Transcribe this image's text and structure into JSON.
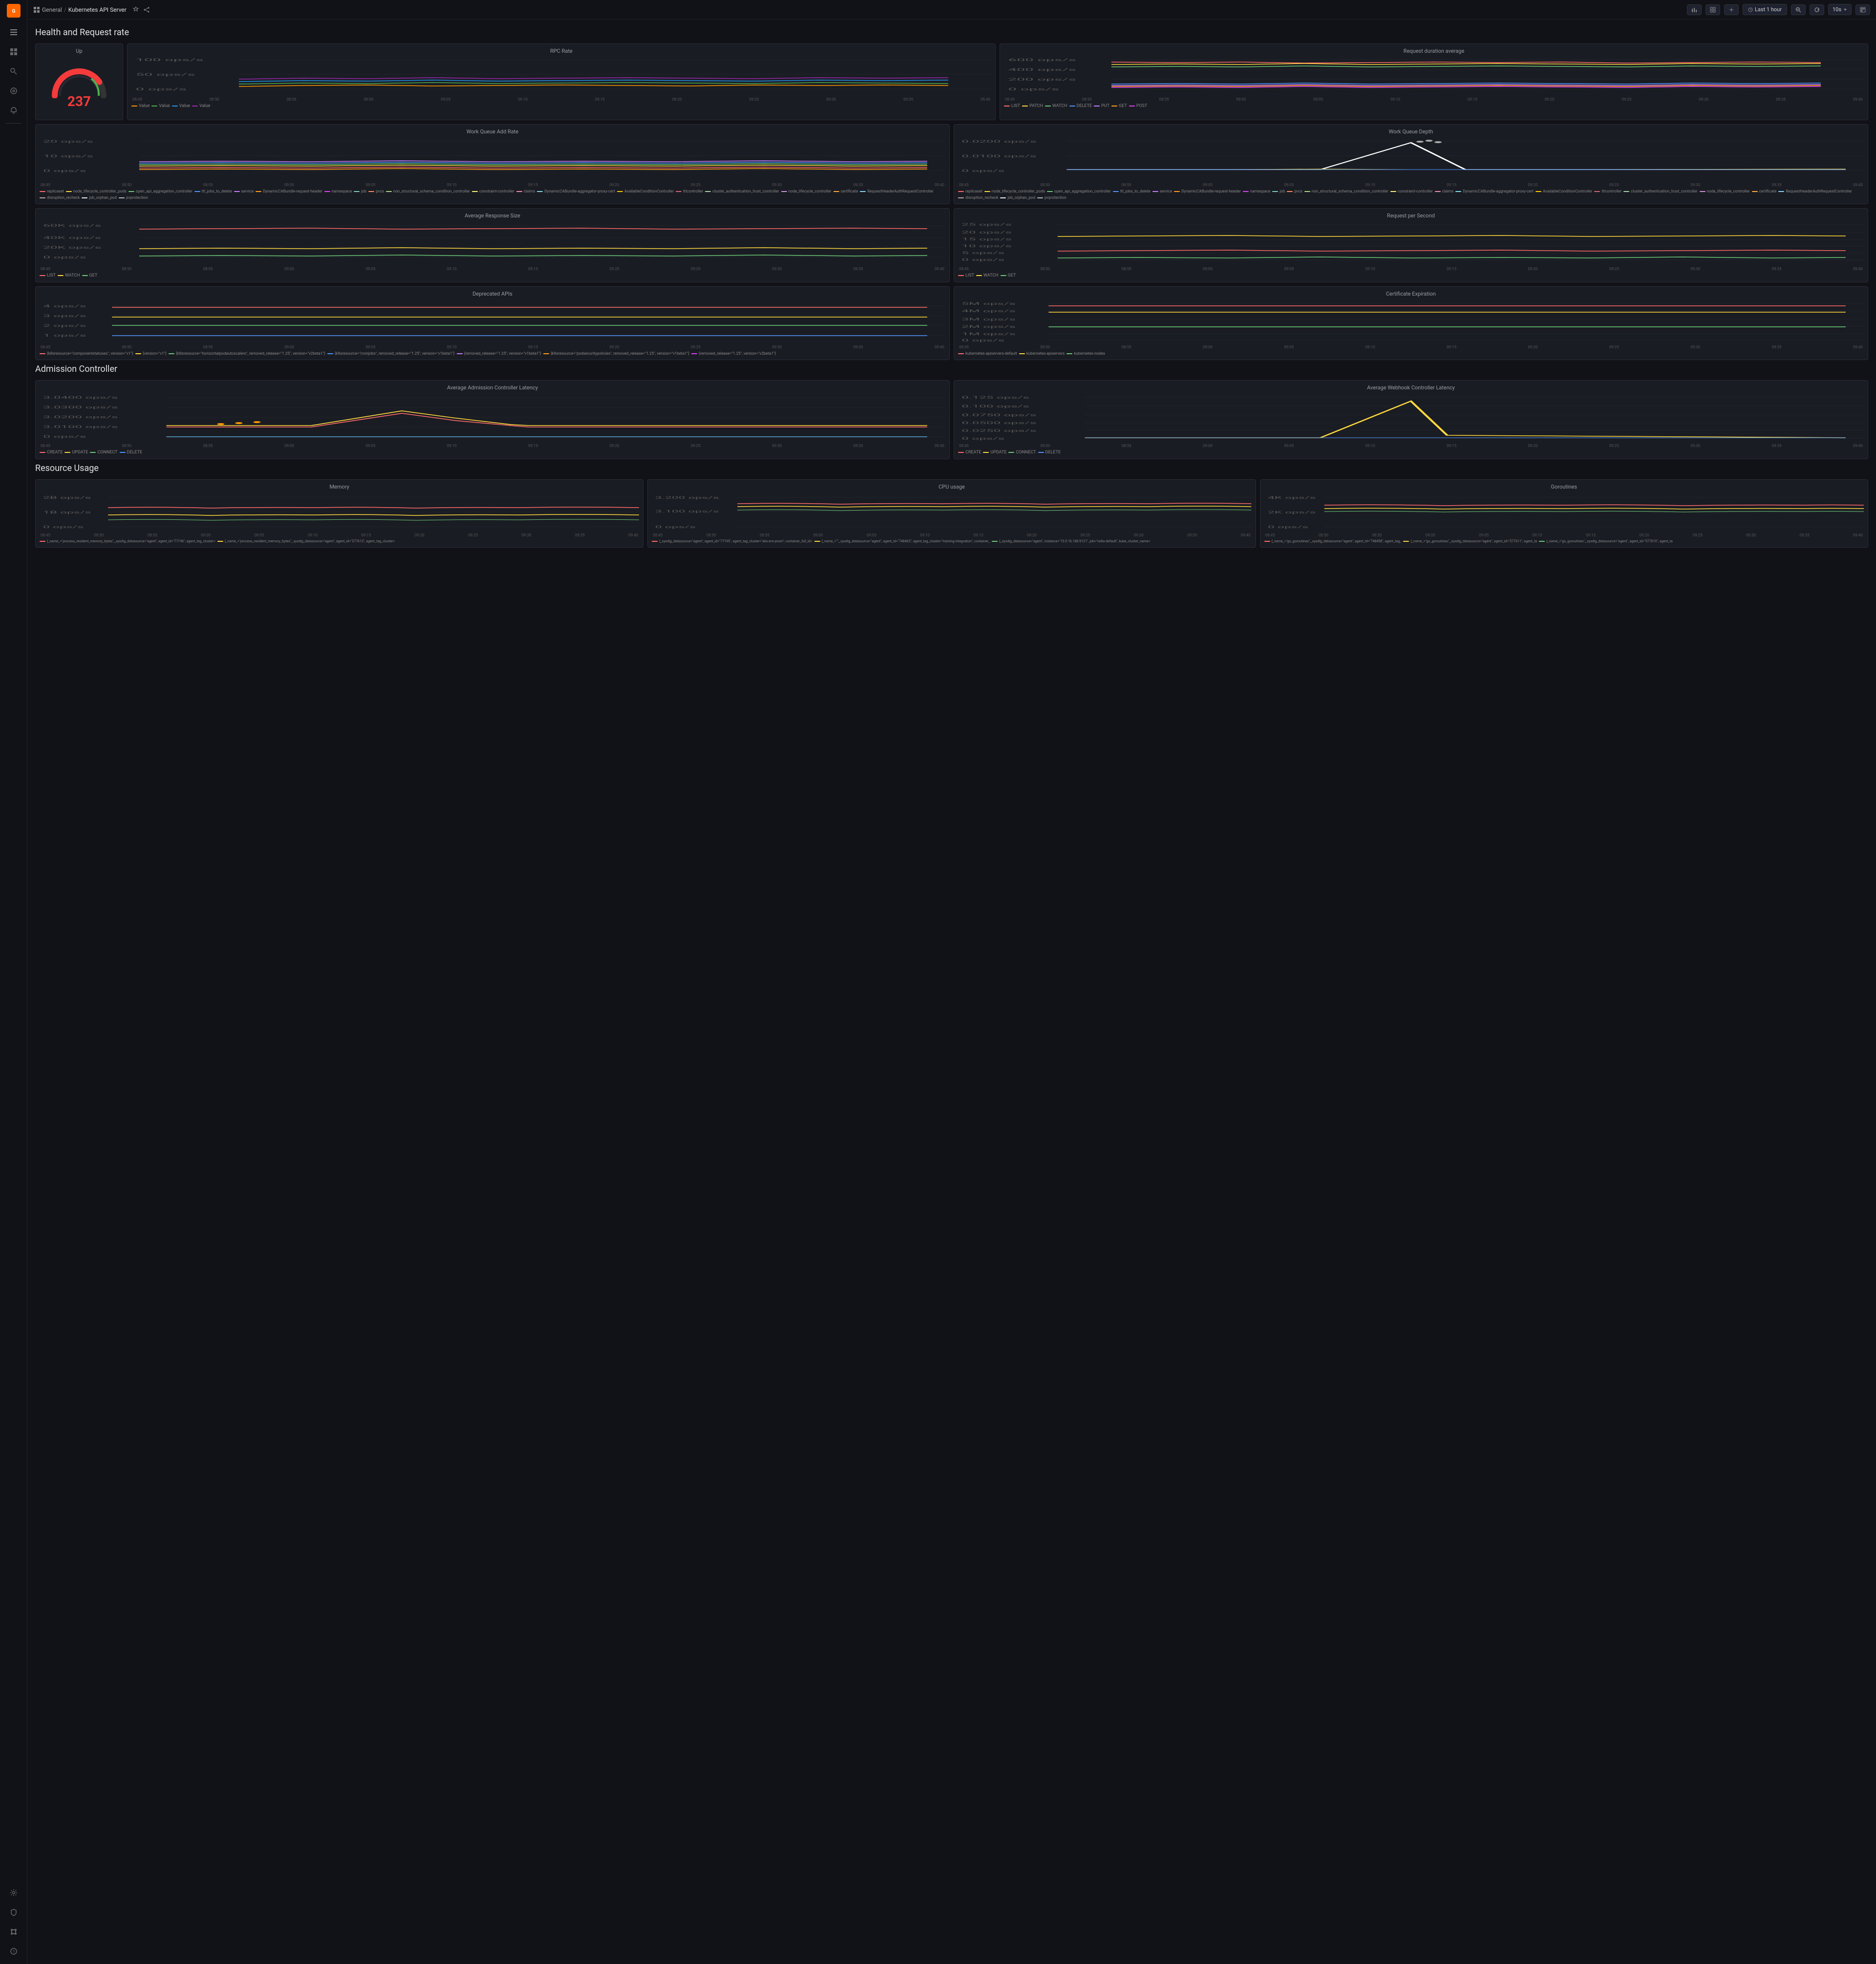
{
  "app": {
    "logo": "G",
    "breadcrumb": {
      "parent": "General",
      "separator": "/",
      "current": "Kubernetes API Server"
    }
  },
  "topbar": {
    "timeRange": "Last 1 hour",
    "zoom": "10s",
    "icons": [
      "chart-icon",
      "settings-icon",
      "gear-icon",
      "clock-icon",
      "magnify-icon",
      "refresh-icon",
      "tv-icon"
    ]
  },
  "sections": {
    "health": {
      "title": "Health and Request rate",
      "panels": {
        "up": {
          "title": "Up",
          "value": "237",
          "max": 400
        },
        "rpcRate": {
          "title": "RPC Rate",
          "yLabels": [
            "100 ops/s",
            "50 ops/s",
            "0 ops/s"
          ],
          "legend": [
            {
              "label": "Value",
              "color": "#ff9800"
            },
            {
              "label": "Value",
              "color": "#4caf50"
            },
            {
              "label": "Value",
              "color": "#2196f3"
            },
            {
              "label": "Value",
              "color": "#9c27b0"
            }
          ]
        },
        "requestDuration": {
          "title": "Request duration average",
          "yLabels": [
            "600 ops/s",
            "400 ops/s",
            "200 ops/s",
            "0 ops/s"
          ],
          "legend": [
            {
              "label": "LIST",
              "color": "#ff6b6b"
            },
            {
              "label": "PATCH",
              "color": "#ffd93d"
            },
            {
              "label": "WATCH",
              "color": "#6bcb77"
            },
            {
              "label": "DELETE",
              "color": "#4d96ff"
            },
            {
              "label": "PUT",
              "color": "#c77dff"
            },
            {
              "label": "GET",
              "color": "#ff9f1c"
            },
            {
              "label": "POST",
              "color": "#e040fb"
            }
          ]
        },
        "workQueueAddRate": {
          "title": "Work Queue Add Rate",
          "yLabels": [
            "20 ops/s",
            "10 ops/s",
            "0 ops/s"
          ],
          "legend": [
            {
              "label": "replicaset",
              "color": "#ff6b6b"
            },
            {
              "label": "node_lifecycle_controller_pods",
              "color": "#ffd93d"
            },
            {
              "label": "open_api_aggregation_controller",
              "color": "#6bcb77"
            },
            {
              "label": "ttl_jobs_to_delete",
              "color": "#4d96ff"
            },
            {
              "label": "service",
              "color": "#c77dff"
            },
            {
              "label": "DynamicCABundle-request-header",
              "color": "#ff9f1c"
            },
            {
              "label": "namespace",
              "color": "#e040fb"
            },
            {
              "label": "job",
              "color": "#80cbc4"
            },
            {
              "label": "pvcs",
              "color": "#ff8a65"
            },
            {
              "label": "non_structural_schema_condition_controller",
              "color": "#aed581"
            },
            {
              "label": "constraint-controller",
              "color": "#fff176"
            },
            {
              "label": "claims",
              "color": "#f48fb1"
            },
            {
              "label": "DynamicCABundle-aggregator-proxy-cert",
              "color": "#80deea"
            },
            {
              "label": "AvailableConditionController",
              "color": "#ffcc02"
            },
            {
              "label": "ttlcontroller",
              "color": "#cf6679"
            },
            {
              "label": "cluster_authentication_trust_controller",
              "color": "#a5d6a7"
            },
            {
              "label": "node_lifecycle_controller",
              "color": "#ce93d8"
            },
            {
              "label": "certificate",
              "color": "#ffab40"
            },
            {
              "label": "RequestHeaderAuthRequestController",
              "color": "#81d4fa"
            },
            {
              "label": "disruption_recheck",
              "color": "#bcaaa4"
            },
            {
              "label": "job_orphan_pod",
              "color": "#eeeeee"
            },
            {
              "label": "pvprotection",
              "color": "#b0bec5"
            }
          ]
        },
        "workQueueDepth": {
          "title": "Work Queue Depth",
          "yLabels": [
            "0.0200 ops/s",
            "0.0100 ops/s",
            "0 ops/s"
          ],
          "legend": [
            {
              "label": "replicaset",
              "color": "#ff6b6b"
            },
            {
              "label": "node_lifecycle_controller_pods",
              "color": "#ffd93d"
            },
            {
              "label": "open_api_aggregation_controller",
              "color": "#6bcb77"
            },
            {
              "label": "ttl_jobs_to_delete",
              "color": "#4d96ff"
            },
            {
              "label": "service",
              "color": "#c77dff"
            },
            {
              "label": "DynamicCABundle-request-header",
              "color": "#ff9f1c"
            },
            {
              "label": "namespace",
              "color": "#e040fb"
            },
            {
              "label": "job",
              "color": "#80cbc4"
            },
            {
              "label": "pvcs",
              "color": "#ff8a65"
            },
            {
              "label": "non_structural_schema_condition_controller",
              "color": "#aed581"
            },
            {
              "label": "constraint-controller",
              "color": "#fff176"
            },
            {
              "label": "claims",
              "color": "#f48fb1"
            },
            {
              "label": "DynamicCABundle-aggregator-proxy-cert",
              "color": "#80deea"
            },
            {
              "label": "AvailableConditionController",
              "color": "#ffcc02"
            },
            {
              "label": "ttlcontroller",
              "color": "#cf6679"
            },
            {
              "label": "cluster_authentication_trust_controller",
              "color": "#a5d6a7"
            },
            {
              "label": "node_lifecycle_controller",
              "color": "#ce93d8"
            },
            {
              "label": "certificate",
              "color": "#ffab40"
            },
            {
              "label": "RequestHeaderAuthRequestController",
              "color": "#81d4fa"
            },
            {
              "label": "disruption_recheck",
              "color": "#bcaaa4"
            },
            {
              "label": "job_orphan_pod",
              "color": "#eeeeee"
            },
            {
              "label": "pvprotection",
              "color": "#b0bec5"
            }
          ]
        },
        "avgResponseSize": {
          "title": "Average Response Size",
          "yLabels": [
            "60K ops/s",
            "40K ops/s",
            "20K ops/s",
            "0 ops/s"
          ],
          "legend": [
            {
              "label": "LIST",
              "color": "#ff6b6b"
            },
            {
              "label": "WATCH",
              "color": "#ffd93d"
            },
            {
              "label": "GET",
              "color": "#6bcb77"
            }
          ]
        },
        "requestPerSecond": {
          "title": "Request per Second",
          "yLabels": [
            "25 ops/s",
            "20 ops/s",
            "15 ops/s",
            "10 ops/s",
            "5 ops/s",
            "0 ops/s"
          ],
          "legend": [
            {
              "label": "LIST",
              "color": "#ff6b6b"
            },
            {
              "label": "WATCH",
              "color": "#ffd93d"
            },
            {
              "label": "GET",
              "color": "#6bcb77"
            }
          ]
        },
        "deprecatedAPIs": {
          "title": "Deprecated APIs",
          "yLabels": [
            "4 ops/s",
            "3 ops/s",
            "2 ops/s",
            "1 ops/s"
          ],
          "legend": [
            {
              "label": "{k8sresource=\"componentstatuses\", version=\"v1\"}",
              "color": "#ff6b6b"
            },
            {
              "label": "{version=\"v1\"}",
              "color": "#ffd93d"
            },
            {
              "label": "{k8sresource=\"horizontalpodautoscalers\", removed_release=\"1.25\", version=\"v2beta1\"}",
              "color": "#6bcb77"
            },
            {
              "label": "{k8sresource=\"cronjobs\", removed_release=\"1.25\", version=\"v1beta1\"}",
              "color": "#4d96ff"
            },
            {
              "label": "{removed_release=\"1.25\", version=\"v1beta1\"}",
              "color": "#c77dff"
            },
            {
              "label": "{k8sresource=\"podsecuritypolicies\", removed_release=\"1.25\", version=\"v1beta1\"}",
              "color": "#ff9f1c"
            },
            {
              "label": "{removed_release=\"1.25\", version=\"v2beta1\"}",
              "color": "#e040fb"
            }
          ]
        },
        "certExpiration": {
          "title": "Certificate Expiration",
          "yLabels": [
            "5M ops/s",
            "4M ops/s",
            "3M ops/s",
            "2M ops/s",
            "1M ops/s",
            "0 ops/s"
          ],
          "legend": [
            {
              "label": "kubernetes-apiservers-default",
              "color": "#ff6b6b"
            },
            {
              "label": "kubernetes-apiservers",
              "color": "#ffd93d"
            },
            {
              "label": "kubernetes-nodes",
              "color": "#6bcb77"
            }
          ]
        }
      }
    },
    "admissionController": {
      "title": "Admission Controller",
      "panels": {
        "avgAdmissionLatency": {
          "title": "Average Admission Controller Latency",
          "yLabels": [
            "3.0400 ops/s",
            "3.0300 ops/s",
            "3.0200 ops/s",
            "3.0100 ops/s",
            "0 ops/s"
          ],
          "legend": [
            {
              "label": "CREATE",
              "color": "#ff6b6b"
            },
            {
              "label": "UPDATE",
              "color": "#ffd93d"
            },
            {
              "label": "CONNECT",
              "color": "#6bcb77"
            },
            {
              "label": "DELETE",
              "color": "#4d96ff"
            }
          ]
        },
        "avgWebhookLatency": {
          "title": "Average Webhook Controller Latency",
          "yLabels": [
            "0.125 ops/s",
            "0.100 ops/s",
            "0.0750 ops/s",
            "0.0500 ops/s",
            "0.0250 ops/s",
            "0 ops/s"
          ],
          "legend": [
            {
              "label": "CREATE",
              "color": "#ff6b6b"
            },
            {
              "label": "UPDATE",
              "color": "#ffd93d"
            },
            {
              "label": "CONNECT",
              "color": "#6bcb77"
            },
            {
              "label": "DELETE",
              "color": "#4d96ff"
            }
          ]
        }
      }
    },
    "resourceUsage": {
      "title": "Resource Usage",
      "panels": {
        "memory": {
          "title": "Memory",
          "yLabels": [
            "2B ops/s",
            "1B ops/s",
            "0 ops/s"
          ],
          "legend": [
            {
              "label": "{_name_=\"process_resident_memory_bytes\",_sysdig_datasource=\"agent\", agent_id=\"77196\", agent_tag_cluster=",
              "color": "#ff6b6b"
            },
            {
              "label": "{_name_=\"process_resident_memory_bytes\",_sysdig_datasource=\"agent\", agent_id=\"577613\", agent_tag_cluster=",
              "color": "#ffd93d"
            }
          ]
        },
        "cpuUsage": {
          "title": "CPU usage",
          "yLabels": [
            "3.200 ops/s",
            "3.100 ops/s",
            "0 ops/s"
          ],
          "legend": [
            {
              "label": "{_sysdig_datasource=\"agent\", agent_id=\"77195\", agent_tag_cluster=\"aks-env-prom\", container_full_id=",
              "color": "#ff6b6b"
            },
            {
              "label": "{_name_=\"\",_sysdig_datasource=\"agent\", agent_id=\"748463\", agent_tag_cluster=\"training-integration\", container_",
              "color": "#ffd93d"
            },
            {
              "label": "{_sysdig_datasource=\"agent\", instance=\"10.0.16.186:9121\", job=\"redis-default\", kube_cluster_name=",
              "color": "#6bcb77"
            }
          ]
        },
        "goroutines": {
          "title": "Goroutines",
          "yLabels": [
            "4K ops/s",
            "2K ops/s",
            "0 ops/s"
          ],
          "legend": [
            {
              "label": "{_name_=\"go_goroutines\",_sysdig_datasource=\"agent\", agent_id=\"748458\", agent_tag_",
              "color": "#ff6b6b"
            },
            {
              "label": "{_name_=\"go_goroutines\",_sysdig_datasource=\"agent\", agent_id=\"577611\", agent_ta",
              "color": "#ffd93d"
            },
            {
              "label": "{_name_=\"go_goroutines\",_sysdig_datasource=\"agent\", agent_id=\"577610\", agent_ta",
              "color": "#6bcb77"
            }
          ]
        }
      }
    }
  },
  "xAxisLabels": [
    "08:45",
    "08:50",
    "08:55",
    "09:00",
    "09:05",
    "09:10",
    "09:15",
    "09:20",
    "09:25",
    "09:30",
    "09:35",
    "09:40"
  ],
  "sidebar": {
    "items": [
      {
        "icon": "☰",
        "name": "menu-icon"
      },
      {
        "icon": "⊞",
        "name": "grid-icon"
      },
      {
        "icon": "🔍",
        "name": "search-icon"
      },
      {
        "icon": "◎",
        "name": "explore-icon"
      },
      {
        "icon": "🔔",
        "name": "alerts-icon"
      },
      {
        "icon": "⚙",
        "name": "settings-icon"
      },
      {
        "icon": "🛡",
        "name": "shield-icon"
      },
      {
        "icon": "❂",
        "name": "integrations-icon"
      },
      {
        "icon": "?",
        "name": "help-icon"
      }
    ]
  }
}
